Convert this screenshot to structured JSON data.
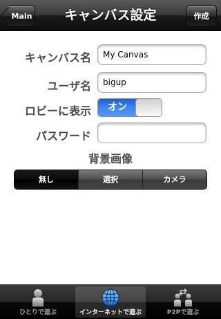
{
  "navbar": {
    "title": "キャンバス設定",
    "back_label": "Main",
    "create_label": "作成"
  },
  "form": {
    "canvas_name": {
      "label": "キャンバス名",
      "value": "My Canvas"
    },
    "user_name": {
      "label": "ユーザ名",
      "value": "bigup"
    },
    "lobby": {
      "label": "ロビーに表示",
      "toggle_on_label": "オン",
      "state": "on"
    },
    "password": {
      "label": "パスワード",
      "value": ""
    }
  },
  "background": {
    "title": "背景画像",
    "options": [
      "無し",
      "選択",
      "カメラ"
    ],
    "selected": "無し"
  },
  "tabbar": {
    "tabs": [
      {
        "label": "ひとりで遊ぶ",
        "icon": "person-icon",
        "active": false
      },
      {
        "label": "インターネットで遊ぶ",
        "icon": "globe-icon",
        "active": true
      },
      {
        "label": "P2Pで遊ぶ",
        "icon": "p2p-icon",
        "active": false
      }
    ]
  },
  "colors": {
    "toggle_on": "#3f86ee",
    "label_text": "#4a4a4a"
  }
}
